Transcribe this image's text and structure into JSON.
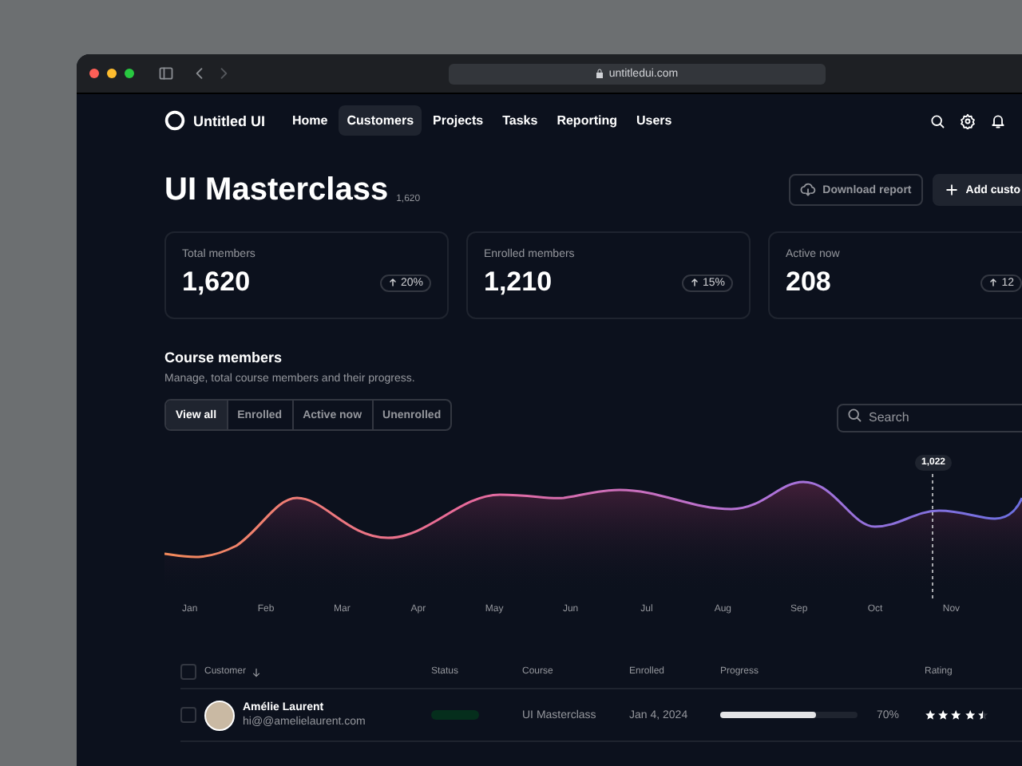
{
  "browser": {
    "url": "untitledui.com"
  },
  "nav": {
    "logo": "Untitled UI",
    "items": [
      {
        "label": "Home",
        "selected": false
      },
      {
        "label": "Customers",
        "selected": true
      },
      {
        "label": "Projects",
        "selected": false
      },
      {
        "label": "Tasks",
        "selected": false
      },
      {
        "label": "Reporting",
        "selected": false
      },
      {
        "label": "Users",
        "selected": false
      }
    ]
  },
  "header": {
    "title": "UI Masterclass",
    "count": "1,620",
    "buttons": [
      {
        "kind": "secondary",
        "label": "Download report"
      },
      {
        "kind": "primary",
        "label": "Add custo"
      }
    ]
  },
  "stats": [
    {
      "label": "Total members",
      "value": "1,620",
      "change": "20%"
    },
    {
      "label": "Enrolled members",
      "value": "1,210",
      "change": "15%"
    },
    {
      "label": "Active now",
      "value": "208",
      "change": "12"
    }
  ],
  "section": {
    "title": "Course members",
    "subtitle": "Manage, total course members and their progress.",
    "filters": [
      {
        "label": "View all",
        "selected": true
      },
      {
        "label": "Enrolled",
        "selected": false
      },
      {
        "label": "Active now",
        "selected": false
      },
      {
        "label": "Unenrolled",
        "selected": false
      }
    ],
    "search": {
      "placeholder": "Search"
    }
  },
  "chart": {
    "tooltip": "1,022",
    "months": [
      "Jan",
      "Feb",
      "Mar",
      "Apr",
      "May",
      "Jun",
      "Jul",
      "Aug",
      "Sep",
      "Oct",
      "Nov"
    ]
  },
  "table": {
    "all_checked": false,
    "columns": [
      "Customer",
      "Status",
      "Course",
      "Enrolled",
      "Progress",
      "Rating"
    ],
    "rows": [
      {
        "checked": false,
        "name": "Amélie Laurent",
        "email": "hi@@amelielaurent.com",
        "course": "UI Masterclass",
        "enrolled": "Jan 4, 2024",
        "level": 0.7,
        "progress": "70%",
        "stars": 4.5
      }
    ]
  }
}
